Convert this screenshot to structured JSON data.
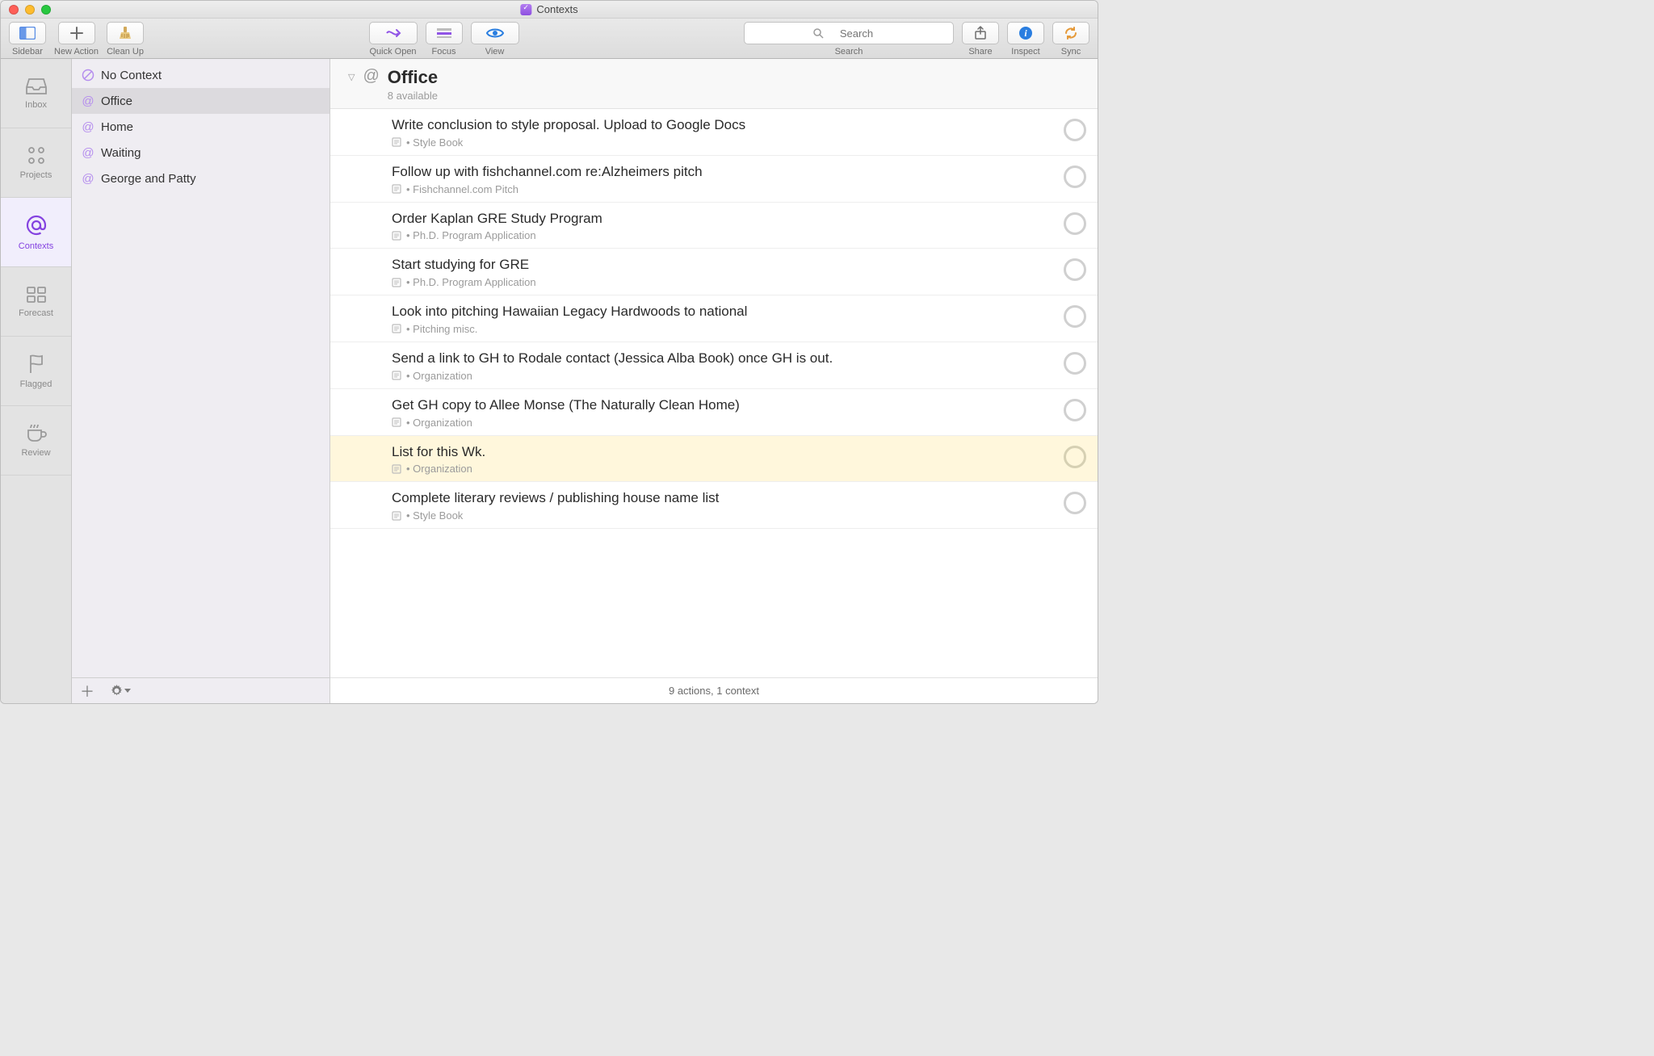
{
  "window": {
    "title": "Contexts"
  },
  "toolbar": {
    "sidebar": "Sidebar",
    "new_action": "New Action",
    "clean_up": "Clean Up",
    "quick_open": "Quick Open",
    "focus": "Focus",
    "view": "View",
    "search": "Search",
    "search_placeholder": "Search",
    "share": "Share",
    "inspect": "Inspect",
    "sync": "Sync"
  },
  "rail": {
    "items": [
      {
        "label": "Inbox"
      },
      {
        "label": "Projects"
      },
      {
        "label": "Contexts"
      },
      {
        "label": "Forecast"
      },
      {
        "label": "Flagged"
      },
      {
        "label": "Review"
      }
    ]
  },
  "contexts": {
    "items": [
      {
        "label": "No Context",
        "no_context": true
      },
      {
        "label": "Office",
        "selected": true
      },
      {
        "label": "Home"
      },
      {
        "label": "Waiting"
      },
      {
        "label": "George and Patty"
      }
    ]
  },
  "header": {
    "title": "Office",
    "subtitle": "8 available"
  },
  "tasks": [
    {
      "title": "Write conclusion to style proposal. Upload to Google Docs",
      "project": "Style Book"
    },
    {
      "title": "Follow up with fishchannel.com re:Alzheimers pitch",
      "project": "Fishchannel.com Pitch"
    },
    {
      "title": "Order Kaplan GRE Study Program",
      "project": "Ph.D. Program Application"
    },
    {
      "title": "Start studying for GRE",
      "project": "Ph.D. Program Application"
    },
    {
      "title": "Look into pitching Hawaiian Legacy Hardwoods to national",
      "project": "Pitching misc."
    },
    {
      "title": "Send a link to GH to Rodale contact (Jessica Alba Book) once GH is out.",
      "project": "Organization"
    },
    {
      "title": "Get GH copy to Allee Monse (The Naturally Clean Home)",
      "project": "Organization"
    },
    {
      "title": "List for this Wk.",
      "project": "Organization",
      "highlight": true
    },
    {
      "title": "Complete literary reviews / publishing house name list",
      "project": "Style Book"
    }
  ],
  "footer": {
    "status": "9 actions, 1 context"
  }
}
